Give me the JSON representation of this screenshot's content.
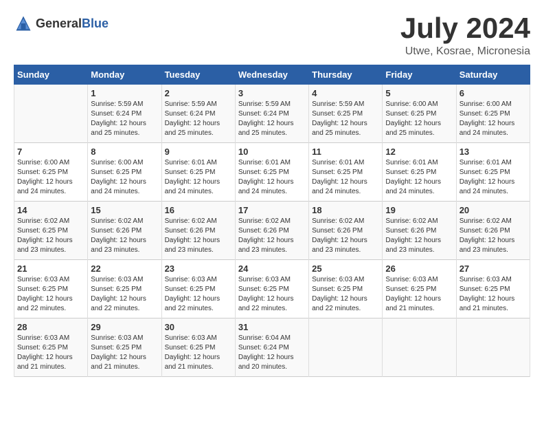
{
  "logo": {
    "general": "General",
    "blue": "Blue"
  },
  "title": "July 2024",
  "location": "Utwe, Kosrae, Micronesia",
  "days_of_week": [
    "Sunday",
    "Monday",
    "Tuesday",
    "Wednesday",
    "Thursday",
    "Friday",
    "Saturday"
  ],
  "weeks": [
    [
      {
        "day": "",
        "sunrise": "",
        "sunset": "",
        "daylight": ""
      },
      {
        "day": "1",
        "sunrise": "Sunrise: 5:59 AM",
        "sunset": "Sunset: 6:24 PM",
        "daylight": "Daylight: 12 hours and 25 minutes."
      },
      {
        "day": "2",
        "sunrise": "Sunrise: 5:59 AM",
        "sunset": "Sunset: 6:24 PM",
        "daylight": "Daylight: 12 hours and 25 minutes."
      },
      {
        "day": "3",
        "sunrise": "Sunrise: 5:59 AM",
        "sunset": "Sunset: 6:24 PM",
        "daylight": "Daylight: 12 hours and 25 minutes."
      },
      {
        "day": "4",
        "sunrise": "Sunrise: 5:59 AM",
        "sunset": "Sunset: 6:25 PM",
        "daylight": "Daylight: 12 hours and 25 minutes."
      },
      {
        "day": "5",
        "sunrise": "Sunrise: 6:00 AM",
        "sunset": "Sunset: 6:25 PM",
        "daylight": "Daylight: 12 hours and 25 minutes."
      },
      {
        "day": "6",
        "sunrise": "Sunrise: 6:00 AM",
        "sunset": "Sunset: 6:25 PM",
        "daylight": "Daylight: 12 hours and 24 minutes."
      }
    ],
    [
      {
        "day": "7",
        "sunrise": "Sunrise: 6:00 AM",
        "sunset": "Sunset: 6:25 PM",
        "daylight": "Daylight: 12 hours and 24 minutes."
      },
      {
        "day": "8",
        "sunrise": "Sunrise: 6:00 AM",
        "sunset": "Sunset: 6:25 PM",
        "daylight": "Daylight: 12 hours and 24 minutes."
      },
      {
        "day": "9",
        "sunrise": "Sunrise: 6:01 AM",
        "sunset": "Sunset: 6:25 PM",
        "daylight": "Daylight: 12 hours and 24 minutes."
      },
      {
        "day": "10",
        "sunrise": "Sunrise: 6:01 AM",
        "sunset": "Sunset: 6:25 PM",
        "daylight": "Daylight: 12 hours and 24 minutes."
      },
      {
        "day": "11",
        "sunrise": "Sunrise: 6:01 AM",
        "sunset": "Sunset: 6:25 PM",
        "daylight": "Daylight: 12 hours and 24 minutes."
      },
      {
        "day": "12",
        "sunrise": "Sunrise: 6:01 AM",
        "sunset": "Sunset: 6:25 PM",
        "daylight": "Daylight: 12 hours and 24 minutes."
      },
      {
        "day": "13",
        "sunrise": "Sunrise: 6:01 AM",
        "sunset": "Sunset: 6:25 PM",
        "daylight": "Daylight: 12 hours and 24 minutes."
      }
    ],
    [
      {
        "day": "14",
        "sunrise": "Sunrise: 6:02 AM",
        "sunset": "Sunset: 6:25 PM",
        "daylight": "Daylight: 12 hours and 23 minutes."
      },
      {
        "day": "15",
        "sunrise": "Sunrise: 6:02 AM",
        "sunset": "Sunset: 6:26 PM",
        "daylight": "Daylight: 12 hours and 23 minutes."
      },
      {
        "day": "16",
        "sunrise": "Sunrise: 6:02 AM",
        "sunset": "Sunset: 6:26 PM",
        "daylight": "Daylight: 12 hours and 23 minutes."
      },
      {
        "day": "17",
        "sunrise": "Sunrise: 6:02 AM",
        "sunset": "Sunset: 6:26 PM",
        "daylight": "Daylight: 12 hours and 23 minutes."
      },
      {
        "day": "18",
        "sunrise": "Sunrise: 6:02 AM",
        "sunset": "Sunset: 6:26 PM",
        "daylight": "Daylight: 12 hours and 23 minutes."
      },
      {
        "day": "19",
        "sunrise": "Sunrise: 6:02 AM",
        "sunset": "Sunset: 6:26 PM",
        "daylight": "Daylight: 12 hours and 23 minutes."
      },
      {
        "day": "20",
        "sunrise": "Sunrise: 6:02 AM",
        "sunset": "Sunset: 6:26 PM",
        "daylight": "Daylight: 12 hours and 23 minutes."
      }
    ],
    [
      {
        "day": "21",
        "sunrise": "Sunrise: 6:03 AM",
        "sunset": "Sunset: 6:25 PM",
        "daylight": "Daylight: 12 hours and 22 minutes."
      },
      {
        "day": "22",
        "sunrise": "Sunrise: 6:03 AM",
        "sunset": "Sunset: 6:25 PM",
        "daylight": "Daylight: 12 hours and 22 minutes."
      },
      {
        "day": "23",
        "sunrise": "Sunrise: 6:03 AM",
        "sunset": "Sunset: 6:25 PM",
        "daylight": "Daylight: 12 hours and 22 minutes."
      },
      {
        "day": "24",
        "sunrise": "Sunrise: 6:03 AM",
        "sunset": "Sunset: 6:25 PM",
        "daylight": "Daylight: 12 hours and 22 minutes."
      },
      {
        "day": "25",
        "sunrise": "Sunrise: 6:03 AM",
        "sunset": "Sunset: 6:25 PM",
        "daylight": "Daylight: 12 hours and 22 minutes."
      },
      {
        "day": "26",
        "sunrise": "Sunrise: 6:03 AM",
        "sunset": "Sunset: 6:25 PM",
        "daylight": "Daylight: 12 hours and 21 minutes."
      },
      {
        "day": "27",
        "sunrise": "Sunrise: 6:03 AM",
        "sunset": "Sunset: 6:25 PM",
        "daylight": "Daylight: 12 hours and 21 minutes."
      }
    ],
    [
      {
        "day": "28",
        "sunrise": "Sunrise: 6:03 AM",
        "sunset": "Sunset: 6:25 PM",
        "daylight": "Daylight: 12 hours and 21 minutes."
      },
      {
        "day": "29",
        "sunrise": "Sunrise: 6:03 AM",
        "sunset": "Sunset: 6:25 PM",
        "daylight": "Daylight: 12 hours and 21 minutes."
      },
      {
        "day": "30",
        "sunrise": "Sunrise: 6:03 AM",
        "sunset": "Sunset: 6:25 PM",
        "daylight": "Daylight: 12 hours and 21 minutes."
      },
      {
        "day": "31",
        "sunrise": "Sunrise: 6:04 AM",
        "sunset": "Sunset: 6:24 PM",
        "daylight": "Daylight: 12 hours and 20 minutes."
      },
      {
        "day": "",
        "sunrise": "",
        "sunset": "",
        "daylight": ""
      },
      {
        "day": "",
        "sunrise": "",
        "sunset": "",
        "daylight": ""
      },
      {
        "day": "",
        "sunrise": "",
        "sunset": "",
        "daylight": ""
      }
    ]
  ]
}
